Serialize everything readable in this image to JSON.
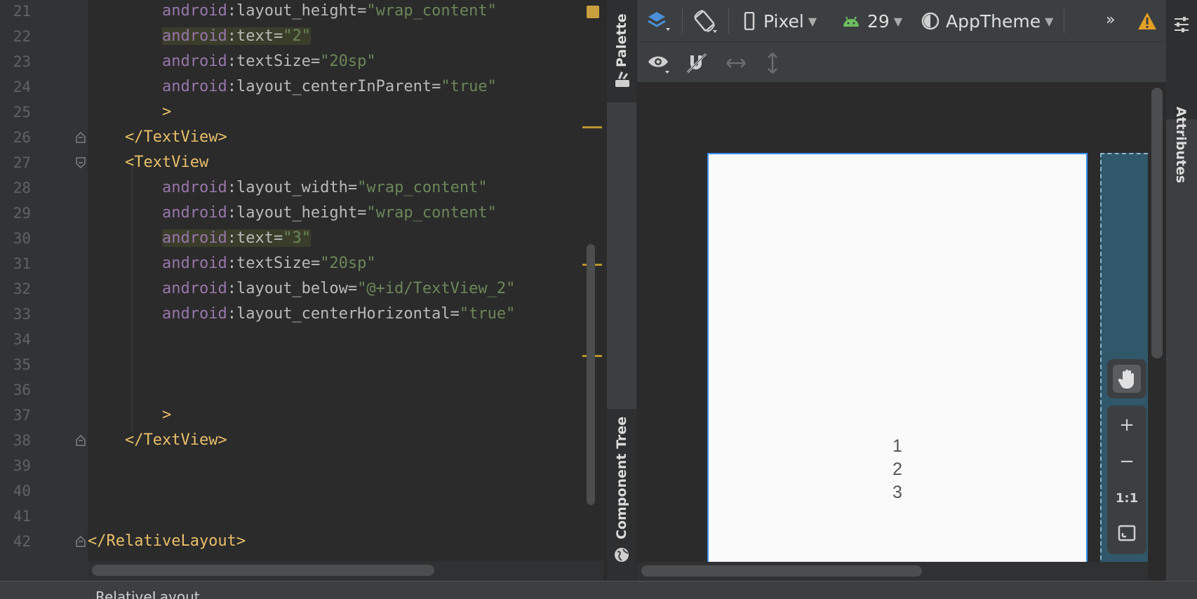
{
  "editor": {
    "lines": [
      {
        "no": "21",
        "tokens": [
          {
            "t": "ns",
            "v": "android"
          },
          {
            "t": "eq",
            "v": ":"
          },
          {
            "t": "attr",
            "v": "layout_height"
          },
          {
            "t": "eq",
            "v": "="
          },
          {
            "t": "str",
            "v": "\"wrap_content\""
          }
        ]
      },
      {
        "no": "22",
        "tokens": [
          {
            "t": "hl-ns",
            "v": "android"
          },
          {
            "t": "hl-eq",
            "v": ":"
          },
          {
            "t": "hl-attr",
            "v": "text"
          },
          {
            "t": "hl-eq",
            "v": "="
          },
          {
            "t": "hl-str",
            "v": "\"2\""
          }
        ]
      },
      {
        "no": "23",
        "tokens": [
          {
            "t": "ns",
            "v": "android"
          },
          {
            "t": "eq",
            "v": ":"
          },
          {
            "t": "attr",
            "v": "textSize"
          },
          {
            "t": "eq",
            "v": "="
          },
          {
            "t": "str",
            "v": "\"20sp\""
          }
        ]
      },
      {
        "no": "24",
        "tokens": [
          {
            "t": "ns",
            "v": "android"
          },
          {
            "t": "eq",
            "v": ":"
          },
          {
            "t": "attr",
            "v": "layout_centerInParent"
          },
          {
            "t": "eq",
            "v": "="
          },
          {
            "t": "str",
            "v": "\"true\""
          }
        ]
      },
      {
        "no": "25",
        "tokens": [
          {
            "t": "tag",
            "v": ">"
          }
        ]
      },
      {
        "no": "26",
        "tokens": [
          {
            "t": "tag",
            "v": "</TextView>"
          }
        ]
      },
      {
        "no": "27",
        "tokens": [
          {
            "t": "tag",
            "v": "<TextView"
          }
        ]
      },
      {
        "no": "28",
        "tokens": [
          {
            "t": "ns",
            "v": "android"
          },
          {
            "t": "eq",
            "v": ":"
          },
          {
            "t": "attr",
            "v": "layout_width"
          },
          {
            "t": "eq",
            "v": "="
          },
          {
            "t": "str",
            "v": "\"wrap_content\""
          }
        ]
      },
      {
        "no": "29",
        "tokens": [
          {
            "t": "ns",
            "v": "android"
          },
          {
            "t": "eq",
            "v": ":"
          },
          {
            "t": "attr",
            "v": "layout_height"
          },
          {
            "t": "eq",
            "v": "="
          },
          {
            "t": "str",
            "v": "\"wrap_content\""
          }
        ]
      },
      {
        "no": "30",
        "tokens": [
          {
            "t": "hl-ns",
            "v": "android"
          },
          {
            "t": "hl-eq",
            "v": ":"
          },
          {
            "t": "hl-attr",
            "v": "text"
          },
          {
            "t": "hl-eq",
            "v": "="
          },
          {
            "t": "hl-str",
            "v": "\"3\""
          }
        ]
      },
      {
        "no": "31",
        "tokens": [
          {
            "t": "ns",
            "v": "android"
          },
          {
            "t": "eq",
            "v": ":"
          },
          {
            "t": "attr",
            "v": "textSize"
          },
          {
            "t": "eq",
            "v": "="
          },
          {
            "t": "str",
            "v": "\"20sp\""
          }
        ]
      },
      {
        "no": "32",
        "tokens": [
          {
            "t": "ns",
            "v": "android"
          },
          {
            "t": "eq",
            "v": ":"
          },
          {
            "t": "attr",
            "v": "layout_below"
          },
          {
            "t": "eq",
            "v": "="
          },
          {
            "t": "str",
            "v": "\"@+id/TextView_2\""
          }
        ]
      },
      {
        "no": "33",
        "tokens": [
          {
            "t": "ns",
            "v": "android"
          },
          {
            "t": "eq",
            "v": ":"
          },
          {
            "t": "attr",
            "v": "layout_centerHorizontal"
          },
          {
            "t": "eq",
            "v": "="
          },
          {
            "t": "str",
            "v": "\"true\""
          }
        ]
      },
      {
        "no": "34",
        "tokens": []
      },
      {
        "no": "35",
        "tokens": []
      },
      {
        "no": "36",
        "tokens": []
      },
      {
        "no": "37",
        "tokens": [
          {
            "t": "tag",
            "v": ">"
          }
        ]
      },
      {
        "no": "38",
        "tokens": [
          {
            "t": "tag",
            "v": "</TextView>"
          }
        ]
      },
      {
        "no": "39",
        "tokens": []
      },
      {
        "no": "40",
        "tokens": []
      },
      {
        "no": "41",
        "tokens": []
      },
      {
        "no": "42",
        "tokens": [
          {
            "t": "tag",
            "v": "</RelativeLayout>"
          }
        ]
      }
    ]
  },
  "side_tabs": {
    "palette": "Palette",
    "component_tree": "Component Tree",
    "attributes": "Attributes"
  },
  "toolbar": {
    "device": "Pixel",
    "api_level": "29",
    "theme": "AppTheme",
    "overflow": "»"
  },
  "preview": {
    "texts": [
      "1",
      "2",
      "3"
    ]
  },
  "zoom": {
    "zoom_in": "+",
    "zoom_out": "−",
    "actual_size": "1:1"
  },
  "status": {
    "breadcrumb": "RelativeLayout"
  },
  "colors": {
    "accent_blue": "#3d8ef7",
    "warning": "#e2a125",
    "android_green": "#6dbf5f"
  }
}
